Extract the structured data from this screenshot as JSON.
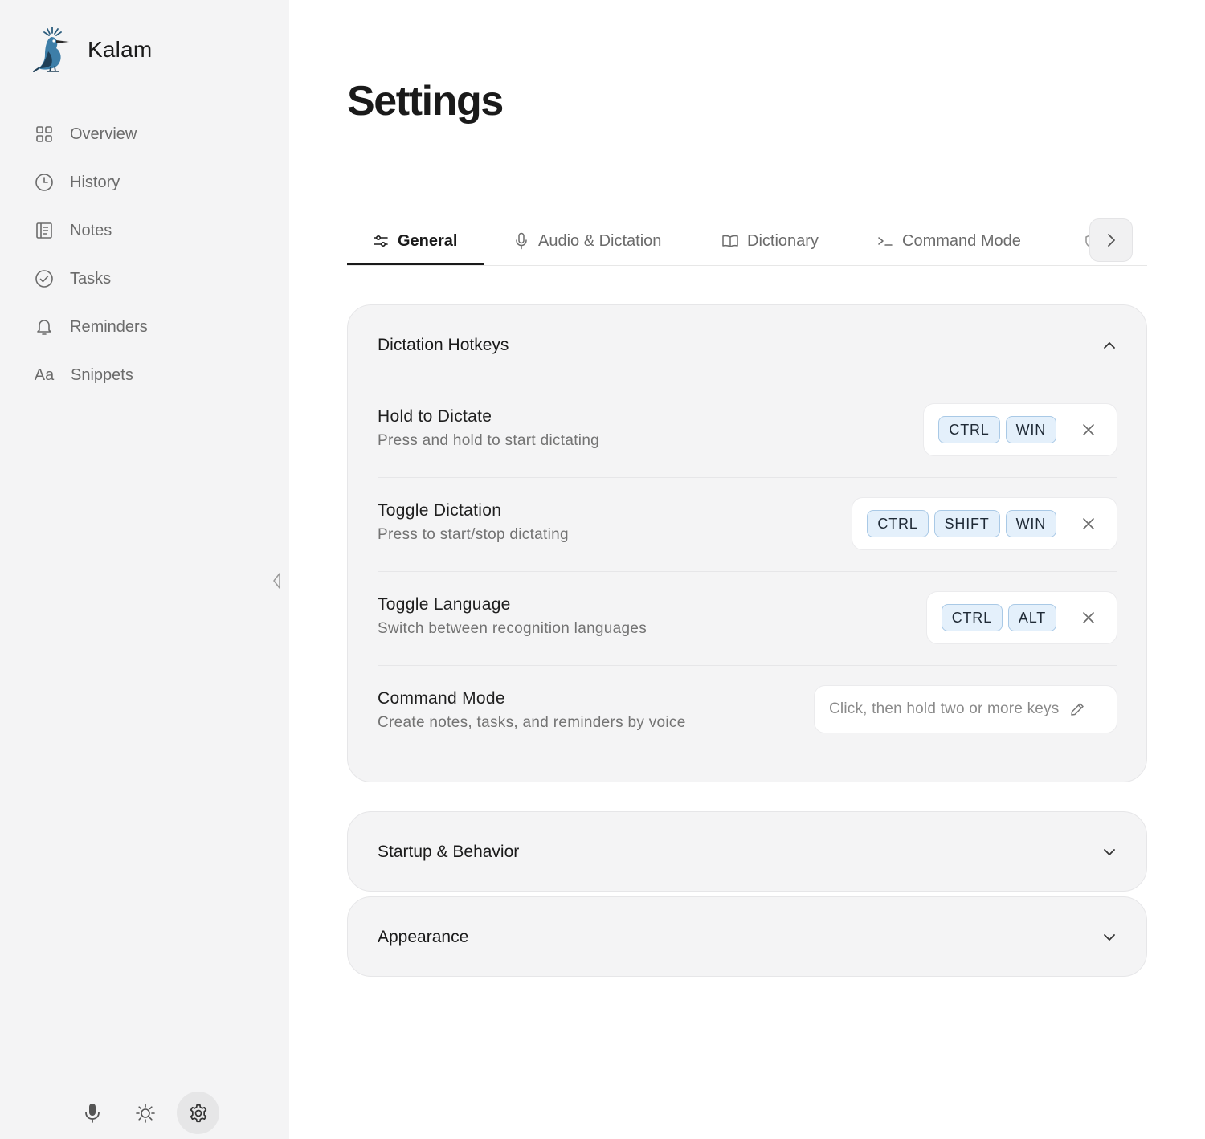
{
  "app": {
    "name": "Kalam"
  },
  "sidebar": {
    "items": [
      {
        "label": "Overview",
        "icon": "grid-icon"
      },
      {
        "label": "History",
        "icon": "clock-icon"
      },
      {
        "label": "Notes",
        "icon": "notebook-icon"
      },
      {
        "label": "Tasks",
        "icon": "check-circle-icon"
      },
      {
        "label": "Reminders",
        "icon": "bell-icon"
      },
      {
        "label": "Snippets",
        "icon": "text-aa-icon",
        "glyph": "Aa"
      }
    ],
    "bottom": [
      "microphone-icon",
      "sun-icon",
      "gear-icon"
    ]
  },
  "page": {
    "title": "Settings"
  },
  "tabs": [
    {
      "label": "General",
      "icon": "sliders-icon",
      "active": true
    },
    {
      "label": "Audio & Dictation",
      "icon": "microphone-icon"
    },
    {
      "label": "Dictionary",
      "icon": "book-icon"
    },
    {
      "label": "Command Mode",
      "icon": "terminal-icon"
    }
  ],
  "sections": {
    "hotkeys": {
      "title": "Dictation Hotkeys",
      "expanded": true,
      "rows": [
        {
          "title": "Hold to Dictate",
          "desc": "Press and hold to start dictating",
          "keys": [
            "CTRL",
            "WIN"
          ]
        },
        {
          "title": "Toggle Dictation",
          "desc": "Press to start/stop dictating",
          "keys": [
            "CTRL",
            "SHIFT",
            "WIN"
          ]
        },
        {
          "title": "Toggle Language",
          "desc": "Switch between recognition languages",
          "keys": [
            "CTRL",
            "ALT"
          ]
        },
        {
          "title": "Command Mode",
          "desc": "Create notes, tasks, and reminders by voice",
          "placeholder": "Click, then hold two or more keys"
        }
      ]
    },
    "startup": {
      "title": "Startup & Behavior",
      "expanded": false
    },
    "appearance": {
      "title": "Appearance",
      "expanded": false
    }
  },
  "colors": {
    "accent": "#1a1a1a",
    "keycap_bg": "#e4f0fb",
    "keycap_border": "#a9c9e6",
    "panel_bg": "#f4f4f5",
    "sidebar_bg": "#f4f4f5"
  }
}
